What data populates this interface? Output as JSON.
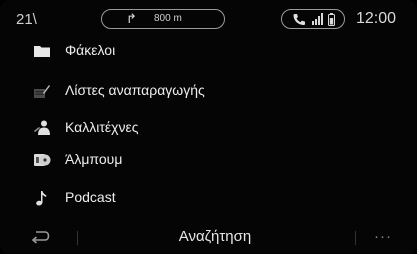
{
  "status": {
    "temperature": "21\\",
    "nav_distance": "800 m",
    "nav_arrow": "↱",
    "clock": "12:00"
  },
  "menu": {
    "items": [
      {
        "label": "Φάκελοι",
        "icon": "folder-icon"
      },
      {
        "label": "Λίστες αναπαραγωγής",
        "icon": "playlist-icon"
      },
      {
        "label": "Καλλιτέχνες",
        "icon": "artist-icon"
      },
      {
        "label": "Άλμπουμ",
        "icon": "album-icon"
      },
      {
        "label": "Podcast",
        "icon": "music-note-icon"
      }
    ]
  },
  "bottom": {
    "search_label": "Αναζήτηση",
    "more_label": "···"
  }
}
